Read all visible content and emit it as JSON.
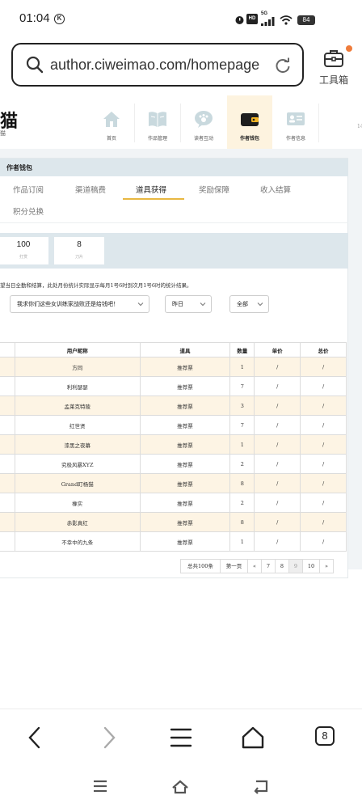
{
  "status_bar": {
    "time": "01:04",
    "k_badge": "K",
    "network": "HD",
    "signal": "5G",
    "battery": "84"
  },
  "address_bar": {
    "url": "author.ciweimao.com/homepage"
  },
  "toolbox": {
    "label": "工具箱"
  },
  "site": {
    "logo": "猫",
    "logo_sub": "猫",
    "nav": [
      {
        "label": "首页",
        "icon": "home-icon"
      },
      {
        "label": "作品管理",
        "icon": "book-icon"
      },
      {
        "label": "读者互动",
        "icon": "paw-icon"
      },
      {
        "label": "作者钱包",
        "icon": "wallet-icon"
      },
      {
        "label": "作者信息",
        "icon": "id-card-icon"
      }
    ],
    "edge_number": "14"
  },
  "panel": {
    "title": "作者钱包",
    "tabs": [
      "作品订阅",
      "渠道稿费",
      "道具获得",
      "奖励保障",
      "收入结算",
      "积分兑换"
    ],
    "active_tab": "道具获得",
    "stats": [
      {
        "value": "100",
        "label": "打赏"
      },
      {
        "value": "8",
        "label": "刀片"
      }
    ],
    "notice": "望当日全勤和结算，此处月份统计实际显示每月1号6时到次月1号6时的统计结果。",
    "filters": {
      "book": "我求你们这些女训练家战败还是给钱吧！",
      "date": "昨日",
      "type": "全部"
    }
  },
  "table": {
    "headers": [
      "用户昵称",
      "道具",
      "数量",
      "单价",
      "总价"
    ],
    "rows": [
      {
        "nick": "方同",
        "item": "推荐票",
        "qty": "1",
        "price": "/",
        "total": "/"
      },
      {
        "nick": "利利瑟瑟",
        "item": "推荐票",
        "qty": "7",
        "price": "/",
        "total": "/"
      },
      {
        "nick": "孟莱克特陵",
        "item": "推荐票",
        "qty": "3",
        "price": "/",
        "total": "/"
      },
      {
        "nick": "红世贤",
        "item": "推荐票",
        "qty": "7",
        "price": "/",
        "total": "/"
      },
      {
        "nick": "漆黑之夜幕",
        "item": "推荐票",
        "qty": "1",
        "price": "/",
        "total": "/"
      },
      {
        "nick": "究极风暴XYZ",
        "item": "推荐票",
        "qty": "2",
        "price": "/",
        "total": "/"
      },
      {
        "nick": "Grand盯杨猫",
        "item": "推荐票",
        "qty": "8",
        "price": "/",
        "total": "/"
      },
      {
        "nick": "橡实",
        "item": "推荐票",
        "qty": "2",
        "price": "/",
        "total": "/"
      },
      {
        "nick": "赤影真红",
        "item": "推荐票",
        "qty": "8",
        "price": "/",
        "total": "/"
      },
      {
        "nick": "不幸中的九条",
        "item": "推荐票",
        "qty": "1",
        "price": "/",
        "total": "/"
      }
    ]
  },
  "pagination": {
    "total": "总共100条",
    "first": "第一页",
    "prev": "«",
    "pages": [
      "7",
      "8",
      "9",
      "10"
    ],
    "current": "9",
    "next": "»"
  },
  "browser_bar": {
    "tab_count": "8"
  }
}
